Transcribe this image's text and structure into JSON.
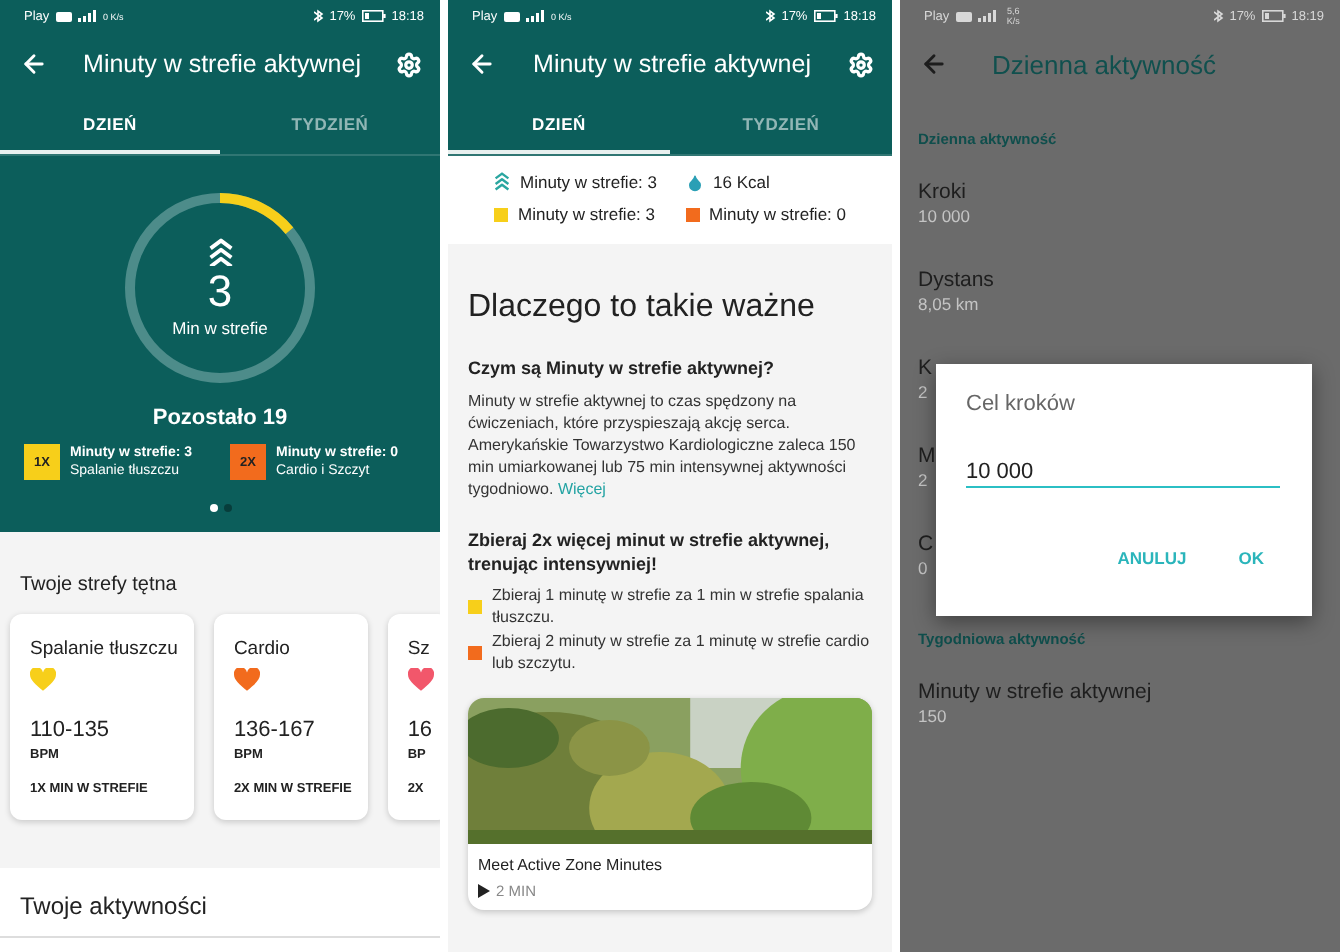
{
  "daily_screen": {
    "status_bar": {
      "carrier": "Play",
      "speed": "0 K/s",
      "battery": "17%",
      "time": "18:18"
    },
    "app_bar": {
      "title": "Minuty w strefie aktywnej"
    },
    "tabs": [
      {
        "label": "DZIEŃ",
        "selected": true
      },
      {
        "label": "TYDZIEŃ",
        "selected": false
      }
    ],
    "ring": {
      "level": 0.14,
      "value": "3",
      "label": "Min w strefie"
    },
    "remaining": "Pozostało 19",
    "zones_legend": [
      {
        "badge": "1X",
        "color": "#f7cf1a",
        "title": "Minuty w strefie: 3",
        "subtitle": "Spalanie tłuszczu"
      },
      {
        "badge": "2X",
        "color": "#f26b1d",
        "title": "Minuty w strefie: 0",
        "subtitle": "Cardio i Szczyt"
      }
    ],
    "page_dots": [
      {
        "selected": true
      },
      {
        "selected": false
      }
    ],
    "heart_zones": {
      "heading": "Twoje strefy tętna",
      "cards": [
        {
          "name": "Spalanie tłuszczu",
          "color": "#f7cf1a",
          "range": "110-135",
          "unit": "BPM",
          "multiplier": "1X MIN W STREFIE"
        },
        {
          "name": "Cardio",
          "color": "#f26b1d",
          "range": "136-167",
          "unit": "BPM",
          "multiplier": "2X MIN W STREFIE"
        },
        {
          "name": "Sz",
          "color": "#f2576b",
          "range": "16",
          "unit": "BP",
          "multiplier": "2X"
        }
      ]
    },
    "activities": {
      "heading": "Twoje aktywności"
    }
  },
  "info_screen": {
    "status_bar": {
      "carrier": "Play",
      "speed": "0 K/s",
      "battery": "17%",
      "time": "18:18"
    },
    "app_bar": {
      "title": "Minuty w strefie aktywnej"
    },
    "tabs": [
      {
        "label": "DZIEŃ",
        "selected": true
      },
      {
        "label": "TYDZIEŃ",
        "selected": false
      }
    ],
    "summary": [
      {
        "kind": "zone",
        "text": "Minuty w strefie: 3"
      },
      {
        "kind": "calories",
        "text": "16 Kcal"
      },
      {
        "kind": "square",
        "color": "#f7cf1a",
        "text": "Minuty w strefie: 3"
      },
      {
        "kind": "square",
        "color": "#f26b1d",
        "text": "Minuty w strefie: 0"
      }
    ],
    "heading": "Dlaczego to takie ważne",
    "question": "Czym są Minuty w strefie aktywnej?",
    "paragraph": "Minuty w strefie aktywnej to czas spędzony na ćwiczeniach, które przyspieszają akcję serca. Amerykańskie Towarzystwo Kardiologiczne zaleca 150 min umiarkowanej lub 75 min intensywnej aktywności tygodniowo.",
    "more_link": "Więcej",
    "subheading": "Zbieraj 2x więcej minut w strefie aktywnej, trenując intensywniej!",
    "bullets": [
      {
        "color": "#f7cf1a",
        "text": "Zbieraj 1 minutę w strefie za 1 min w strefie spalania tłuszczu."
      },
      {
        "color": "#f26b1d",
        "text": "Zbieraj 2 minuty w strefie za 1 minutę w strefie cardio lub szczytu."
      }
    ],
    "video": {
      "kind": "picture",
      "title": "Meet Active Zone Minutes",
      "duration": "2 MIN"
    }
  },
  "settings_screen": {
    "status_bar": {
      "carrier": "Play",
      "speed": "5,6 K/s",
      "battery": "17%",
      "time": "18:19"
    },
    "title": "Dzienna aktywność",
    "sections": [
      {
        "heading": "Dzienna aktywność",
        "items": [
          {
            "label": "Kroki",
            "value": "10 000"
          },
          {
            "label": "Dystans",
            "value": "8,05 km"
          },
          {
            "label": "K",
            "value": "2"
          },
          {
            "label": "M",
            "value": "2"
          },
          {
            "label": "C",
            "value": "0"
          }
        ]
      },
      {
        "heading": "Tygodniowa aktywność",
        "items": [
          {
            "label": "Minuty w strefie aktywnej",
            "value": "150"
          }
        ]
      }
    ],
    "dialog": {
      "title": "Cel kroków",
      "value": "10 000",
      "buttons": [
        "ANULUJ",
        "OK"
      ]
    }
  }
}
